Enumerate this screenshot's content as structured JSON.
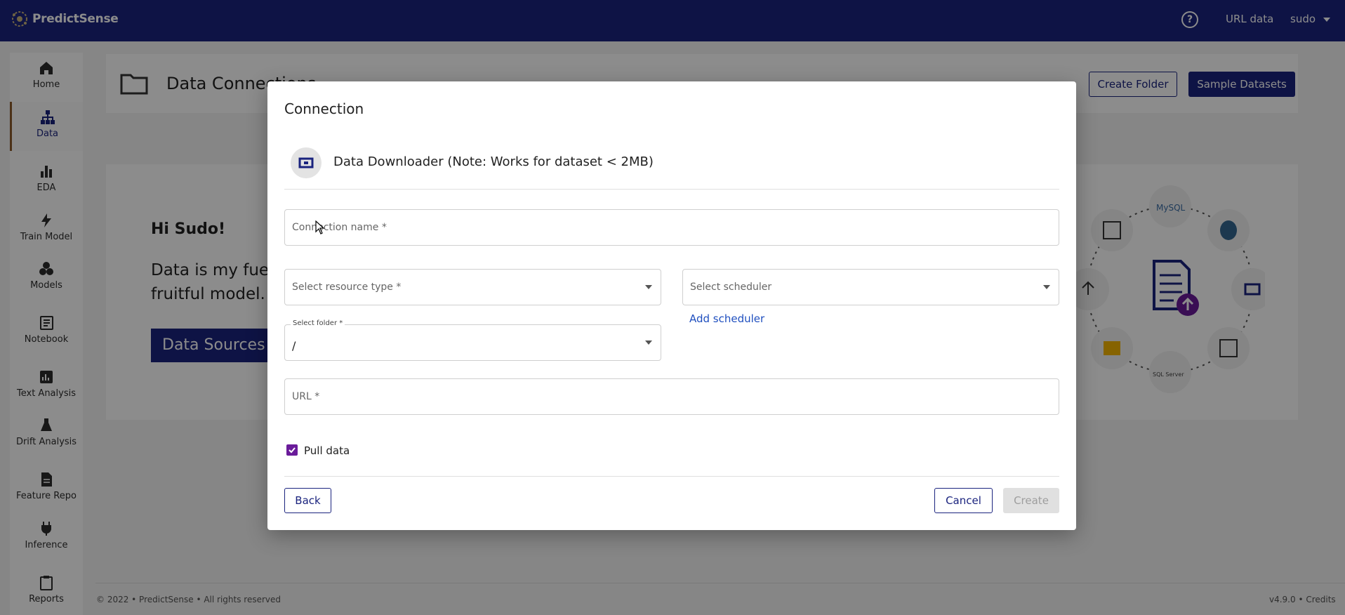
{
  "app": {
    "name": "PredictSense",
    "connection_type": "URL data",
    "user": "sudo"
  },
  "sidebar": {
    "items": [
      {
        "label": "Home",
        "icon": "home-icon"
      },
      {
        "label": "Data",
        "icon": "data-hierarchy-icon"
      },
      {
        "label": "EDA",
        "icon": "bar-chart-icon"
      },
      {
        "label": "Train Model",
        "icon": "lightning-icon"
      },
      {
        "label": "Models",
        "icon": "cubes-icon"
      },
      {
        "label": "Notebook",
        "icon": "notebook-icon"
      },
      {
        "label": "Text Analysis",
        "icon": "text-analysis-icon"
      },
      {
        "label": "Drift Analysis",
        "icon": "flask-icon"
      },
      {
        "label": "Feature Repo",
        "icon": "document-icon"
      },
      {
        "label": "Inference",
        "icon": "plug-icon"
      },
      {
        "label": "Reports",
        "icon": "clipboard-icon"
      }
    ],
    "active": "Data"
  },
  "page": {
    "title": "Data Connections",
    "create_folder": "Create Folder",
    "sample_datasets": "Sample Datasets",
    "greeting": "Hi Sudo!",
    "tagline_1": "Data is my fuel,",
    "tagline_2": "fruitful model.",
    "data_sources": "Data Sources"
  },
  "modal": {
    "title": "Connection",
    "source_label": "Data Downloader (Note: Works for dataset < 2MB)",
    "connection_name_placeholder": "Connection name *",
    "resource_type_placeholder": "Select resource type *",
    "scheduler_placeholder": "Select scheduler",
    "add_scheduler": "Add scheduler",
    "folder_label": "Select folder *",
    "folder_value": "/",
    "url_placeholder": "URL *",
    "pull_data_label": "Pull data",
    "pull_data_checked": true,
    "back": "Back",
    "cancel": "Cancel",
    "create": "Create"
  },
  "footer": {
    "copyright": "© 2022 • PredictSense • All rights reserved",
    "version": "v4.9.0 • Credits"
  },
  "colors": {
    "brand": "#1a237e",
    "checkbox": "#6a1b9a",
    "link": "#1f4fbf"
  }
}
